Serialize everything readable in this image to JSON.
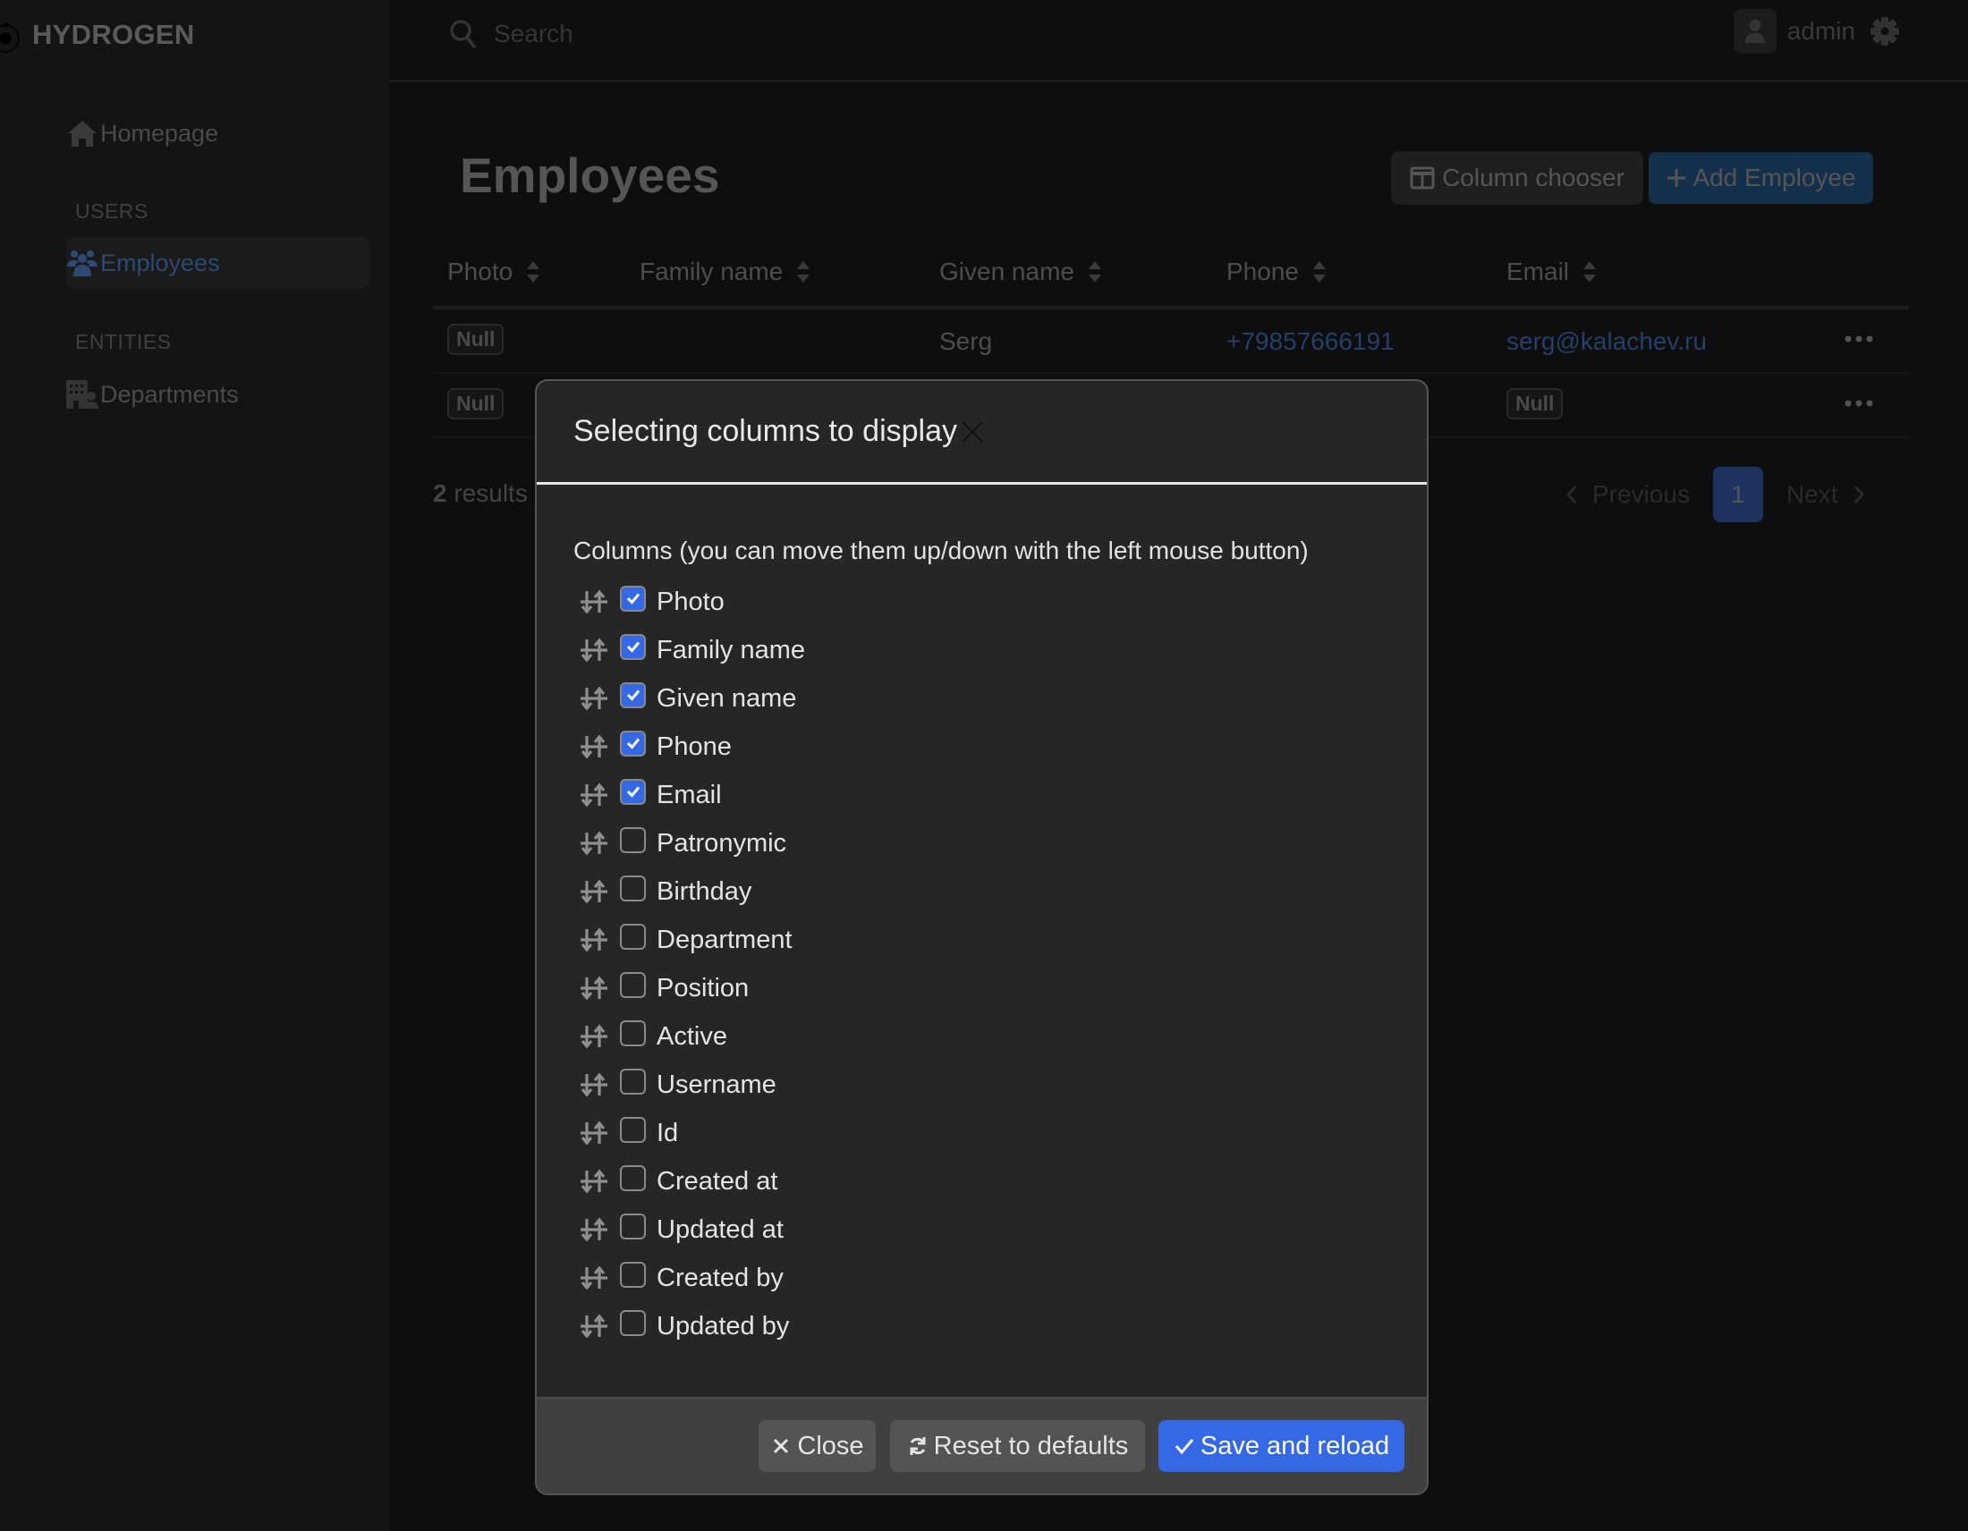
{
  "app": {
    "brand": "HYDROGEN"
  },
  "sidebar": {
    "items": [
      {
        "label": "Homepage",
        "icon": "home-icon"
      },
      {
        "label": "Employees",
        "icon": "users-icon",
        "active": true
      },
      {
        "label": "Departments",
        "icon": "building-user-icon"
      }
    ],
    "sections": [
      "USERS",
      "ENTITIES"
    ]
  },
  "topbar": {
    "search_placeholder": "Search",
    "user_name": "admin"
  },
  "page": {
    "title": "Employees",
    "column_chooser_label": "Column chooser",
    "add_label": "Add Employee"
  },
  "table": {
    "columns": [
      "Photo",
      "Family name",
      "Given name",
      "Phone",
      "Email"
    ],
    "rows": [
      {
        "photo": "Null",
        "family_name": "",
        "given_name": "Serg",
        "phone": "+79857666191",
        "email": "serg@kalachev.ru"
      },
      {
        "photo": "Null",
        "family_name": "",
        "given_name": "",
        "phone": "",
        "email": "Null"
      }
    ],
    "results_count": "2",
    "results_label": "results"
  },
  "pagination": {
    "previous": "Previous",
    "current": "1",
    "next": "Next"
  },
  "modal": {
    "title": "Selecting columns to display",
    "hint": "Columns (you can move them up/down with the left mouse button)",
    "columns": [
      {
        "label": "Photo",
        "checked": true
      },
      {
        "label": "Family name",
        "checked": true
      },
      {
        "label": "Given name",
        "checked": true
      },
      {
        "label": "Phone",
        "checked": true
      },
      {
        "label": "Email",
        "checked": true
      },
      {
        "label": "Patronymic",
        "checked": false
      },
      {
        "label": "Birthday",
        "checked": false
      },
      {
        "label": "Department",
        "checked": false
      },
      {
        "label": "Position",
        "checked": false
      },
      {
        "label": "Active",
        "checked": false
      },
      {
        "label": "Username",
        "checked": false
      },
      {
        "label": "Id",
        "checked": false
      },
      {
        "label": "Created at",
        "checked": false
      },
      {
        "label": "Updated at",
        "checked": false
      },
      {
        "label": "Created by",
        "checked": false
      },
      {
        "label": "Updated by",
        "checked": false
      }
    ],
    "close_label": "Close",
    "reset_label": "Reset to defaults",
    "save_label": "Save and reload"
  },
  "colors": {
    "accent": "#3468e4",
    "link_dim": "#24406a",
    "add_button_dim": "#15304a",
    "page_current_dim": "#1e3260"
  }
}
